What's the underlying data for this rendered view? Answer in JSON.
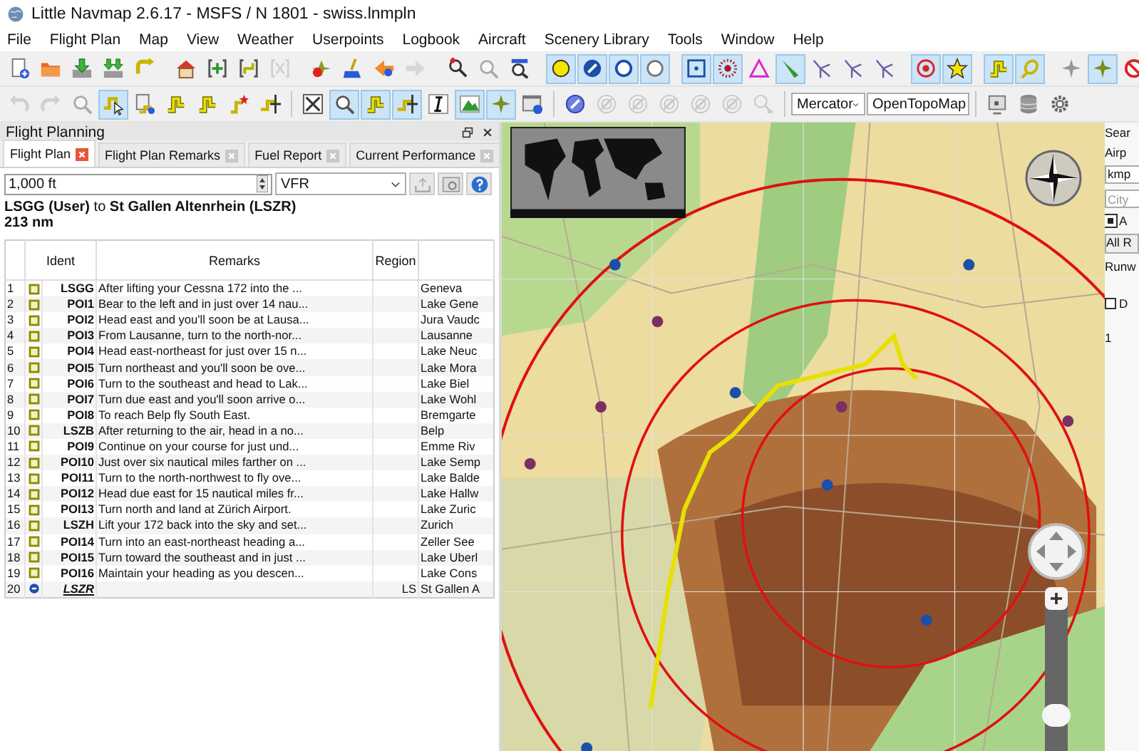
{
  "window": {
    "title": "Little Navmap 2.6.17 - MSFS / N 1801 - swiss.lnmpln"
  },
  "menu": [
    "File",
    "Flight Plan",
    "Map",
    "View",
    "Weather",
    "Userpoints",
    "Logbook",
    "Aircraft",
    "Scenery Library",
    "Tools",
    "Window",
    "Help"
  ],
  "toolbar_1": [
    [
      {
        "kind": "doc",
        "selected": false,
        "disabled": false
      },
      {
        "kind": "folder",
        "selected": false,
        "disabled": false
      },
      {
        "kind": "download",
        "selected": false,
        "disabled": false
      },
      {
        "kind": "download2",
        "selected": false,
        "disabled": false
      },
      {
        "kind": "redo-route",
        "selected": false,
        "disabled": false
      }
    ],
    [
      {
        "kind": "home",
        "selected": false,
        "disabled": false
      },
      {
        "kind": "bracket",
        "selected": false,
        "disabled": false
      },
      {
        "kind": "bracket-route",
        "selected": false,
        "disabled": false
      },
      {
        "kind": "bracket-x",
        "selected": false,
        "disabled": true
      }
    ],
    [
      {
        "kind": "plane-delete",
        "selected": false,
        "disabled": false
      },
      {
        "kind": "broom",
        "selected": false,
        "disabled": false
      },
      {
        "kind": "left",
        "selected": false,
        "disabled": false
      },
      {
        "kind": "right",
        "selected": false,
        "disabled": true
      }
    ],
    [
      {
        "kind": "zoom-pin",
        "selected": false,
        "disabled": false
      },
      {
        "kind": "zoom",
        "selected": false,
        "disabled": true
      },
      {
        "kind": "zoom-box",
        "selected": false,
        "disabled": false
      }
    ],
    [
      {
        "kind": "dot-circle",
        "selected": true,
        "disabled": false
      },
      {
        "kind": "slash-circle",
        "selected": true,
        "disabled": false
      },
      {
        "kind": "ring",
        "selected": true,
        "disabled": false
      },
      {
        "kind": "ring-gray",
        "selected": true,
        "disabled": false
      }
    ],
    [
      {
        "kind": "square-dot",
        "selected": true,
        "disabled": false
      },
      {
        "kind": "dotted-circle",
        "selected": true,
        "disabled": false
      },
      {
        "kind": "triangle",
        "selected": false,
        "disabled": false
      },
      {
        "kind": "needle",
        "selected": true,
        "disabled": false
      },
      {
        "kind": "airway",
        "selected": false,
        "disabled": false
      },
      {
        "kind": "airway",
        "selected": false,
        "disabled": false
      },
      {
        "kind": "airway",
        "selected": false,
        "disabled": false
      }
    ],
    [
      {
        "kind": "target",
        "selected": true,
        "disabled": false
      },
      {
        "kind": "star",
        "selected": true,
        "disabled": false
      }
    ],
    [
      {
        "kind": "route",
        "selected": true,
        "disabled": false
      },
      {
        "kind": "loop",
        "selected": true,
        "disabled": false
      }
    ],
    [
      {
        "kind": "plane",
        "selected": false,
        "disabled": false
      },
      {
        "kind": "plane-green",
        "selected": true,
        "disabled": false
      },
      {
        "kind": "no-plane",
        "selected": false,
        "disabled": false
      }
    ]
  ],
  "toolbar_2": [
    [
      {
        "kind": "undo",
        "selected": false,
        "disabled": true
      },
      {
        "kind": "redo",
        "selected": false,
        "disabled": true
      },
      {
        "kind": "zoom",
        "selected": false,
        "disabled": true
      },
      {
        "kind": "route-cursor",
        "selected": true,
        "disabled": false
      },
      {
        "kind": "doc-route",
        "selected": false,
        "disabled": false
      },
      {
        "kind": "route",
        "selected": false,
        "disabled": false
      },
      {
        "kind": "route",
        "selected": false,
        "disabled": false
      },
      {
        "kind": "route-star",
        "selected": false,
        "disabled": false
      },
      {
        "kind": "route-pin",
        "selected": false,
        "disabled": false
      }
    ],
    [
      {
        "kind": "box-x",
        "selected": false,
        "disabled": false
      },
      {
        "kind": "zoom",
        "selected": true,
        "disabled": false
      },
      {
        "kind": "route",
        "selected": true,
        "disabled": false
      },
      {
        "kind": "route-pin",
        "selected": true,
        "disabled": false
      },
      {
        "kind": "text-cursor",
        "selected": false,
        "disabled": false
      },
      {
        "kind": "mountain",
        "selected": true,
        "disabled": false
      },
      {
        "kind": "plane-green",
        "selected": true,
        "disabled": false
      },
      {
        "kind": "window-help",
        "selected": false,
        "disabled": false
      }
    ],
    [
      {
        "kind": "compass",
        "selected": false,
        "disabled": false
      },
      {
        "kind": "nav",
        "selected": false,
        "disabled": true
      },
      {
        "kind": "nav",
        "selected": false,
        "disabled": true
      },
      {
        "kind": "nav",
        "selected": false,
        "disabled": true
      },
      {
        "kind": "nav",
        "selected": false,
        "disabled": true
      },
      {
        "kind": "nav",
        "selected": false,
        "disabled": true
      },
      {
        "kind": "nav-tool",
        "selected": false,
        "disabled": true
      }
    ]
  ],
  "projection_dropdown": "Mercator",
  "theme_dropdown": "OpenTopoMap",
  "toolbar_3": [
    {
      "kind": "monitor",
      "selected": false,
      "disabled": false
    },
    {
      "kind": "database",
      "selected": false,
      "disabled": false
    },
    {
      "kind": "gear",
      "selected": false,
      "disabled": false
    }
  ],
  "flight_planning": {
    "title": "Flight Planning",
    "tabs": [
      {
        "label": "Flight Plan",
        "selected": true
      },
      {
        "label": "Flight Plan Remarks",
        "selected": false
      },
      {
        "label": "Fuel Report",
        "selected": false
      },
      {
        "label": "Current Performance",
        "selected": false
      }
    ],
    "altitude": "1,000 ft",
    "flight_rules": "VFR",
    "route": "**LSGG (User)** to **St Gallen Altenrhein (LSZR)**",
    "distance": "213 nm",
    "table": {
      "columns": [
        "Ident",
        "Remarks",
        "Region"
      ],
      "rows": [
        {
          "number": "1",
          "kind": "userpoint",
          "ident": "LSGG",
          "remarks": "After lifting your Cessna 172 into the ...",
          "region": "",
          "column_5": "Geneva"
        },
        {
          "number": "2",
          "kind": "userpoint",
          "ident": "POI1",
          "remarks": "Bear to the left and in just over 14 nau...",
          "region": "",
          "column_5": "Lake Gene"
        },
        {
          "number": "3",
          "kind": "userpoint",
          "ident": "POI2",
          "remarks": "Head east and you'll soon be at Lausa...",
          "region": "",
          "column_5": "Jura Vaudc"
        },
        {
          "number": "4",
          "kind": "userpoint",
          "ident": "POI3",
          "remarks": "From Lausanne, turn to the north-nor...",
          "region": "",
          "column_5": "Lausanne"
        },
        {
          "number": "5",
          "kind": "userpoint",
          "ident": "POI4",
          "remarks": "Head east-northeast for just over 15 n...",
          "region": "",
          "column_5": "Lake Neuc"
        },
        {
          "number": "6",
          "kind": "userpoint",
          "ident": "POI5",
          "remarks": "Turn northeast and you'll soon be ove...",
          "region": "",
          "column_5": "Lake Mora"
        },
        {
          "number": "7",
          "kind": "userpoint",
          "ident": "POI6",
          "remarks": "Turn to the southeast and head to Lak...",
          "region": "",
          "column_5": "Lake Biel"
        },
        {
          "number": "8",
          "kind": "userpoint",
          "ident": "POI7",
          "remarks": "Turn due east and you'll soon arrive o...",
          "region": "",
          "column_5": "Lake Wohl"
        },
        {
          "number": "9",
          "kind": "userpoint",
          "ident": "POI8",
          "remarks": "To reach Belp fly South East.",
          "region": "",
          "column_5": "Bremgarte"
        },
        {
          "number": "10",
          "kind": "userpoint",
          "ident": "LSZB",
          "remarks": "After returning to the air, head in a no...",
          "region": "",
          "column_5": "Belp"
        },
        {
          "number": "11",
          "kind": "userpoint",
          "ident": "POI9",
          "remarks": "Continue on your course for just und...",
          "region": "",
          "column_5": "Emme Riv"
        },
        {
          "number": "12",
          "kind": "userpoint",
          "ident": "POI10",
          "remarks": "Just over six nautical miles farther on ...",
          "region": "",
          "column_5": "Lake Semp"
        },
        {
          "number": "13",
          "kind": "userpoint",
          "ident": "POI11",
          "remarks": "Turn to the north-northwest to fly ove...",
          "region": "",
          "column_5": "Lake Balde"
        },
        {
          "number": "14",
          "kind": "userpoint",
          "ident": "POI12",
          "remarks": "Head due east for 15 nautical miles fr...",
          "region": "",
          "column_5": "Lake Hallw"
        },
        {
          "number": "15",
          "kind": "userpoint",
          "ident": "POI13",
          "remarks": "Turn north and land at Zürich Airport.",
          "region": "",
          "column_5": "Lake Zuric"
        },
        {
          "number": "16",
          "kind": "userpoint",
          "ident": "LSZH",
          "remarks": "Lift your 172 back into the sky and set...",
          "region": "",
          "column_5": "Zurich"
        },
        {
          "number": "17",
          "kind": "userpoint",
          "ident": "POI14",
          "remarks": "Turn into an east-northeast heading a...",
          "region": "",
          "column_5": "Zeller See"
        },
        {
          "number": "18",
          "kind": "userpoint",
          "ident": "POI15",
          "remarks": "Turn toward the southeast and in just ...",
          "region": "",
          "column_5": "Lake Uberl"
        },
        {
          "number": "19",
          "kind": "userpoint",
          "ident": "POI16",
          "remarks": "Maintain your heading as you descen...",
          "region": "",
          "column_5": "Lake Cons"
        },
        {
          "number": "20",
          "kind": "airport",
          "ident": "LSZR",
          "remarks": "",
          "region": "LS",
          "column_5": "St Gallen A"
        }
      ]
    }
  },
  "map_zoom": {
    "level": 0.15
  },
  "search_panel": {
    "tab": "Sear",
    "subtab": "Airp",
    "ident_value": "kmp",
    "city_placeholder": "City",
    "filter_checkbox": {
      "label": "A",
      "checked": true
    },
    "combo": "All R",
    "runway_label": "Runw",
    "option_checkbox": {
      "label": "D",
      "checked": false
    },
    "row_number": "1"
  }
}
